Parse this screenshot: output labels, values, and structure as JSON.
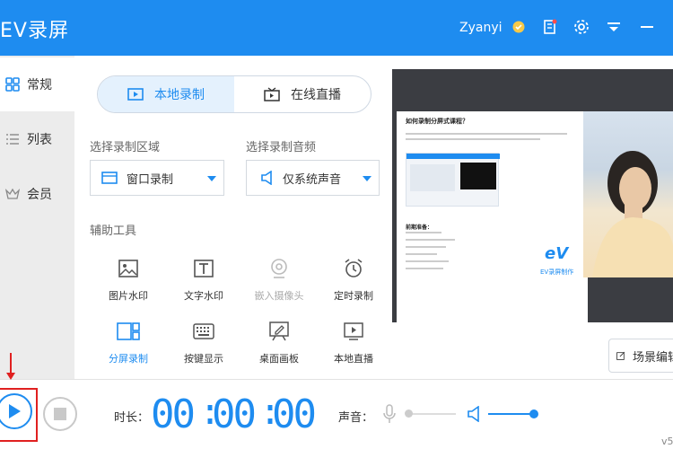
{
  "app": {
    "title": "EV录屏",
    "user": "Zyanyi",
    "version": "v5"
  },
  "sidebar": {
    "items": [
      {
        "label": "常规",
        "icon": "grid-icon"
      },
      {
        "label": "列表",
        "icon": "list-icon"
      },
      {
        "label": "会员",
        "icon": "crown-icon"
      }
    ]
  },
  "mode_tabs": [
    {
      "label": "本地录制",
      "icon": "local-record-icon",
      "active": true
    },
    {
      "label": "在线直播",
      "icon": "live-tv-icon",
      "active": false
    }
  ],
  "capture": {
    "area_label": "选择录制区域",
    "area_value": "窗口录制",
    "audio_label": "选择录制音频",
    "audio_value": "仅系统声音"
  },
  "tools": {
    "label": "辅助工具",
    "items": [
      {
        "label": "图片水印",
        "icon": "image-icon"
      },
      {
        "label": "文字水印",
        "icon": "text-icon"
      },
      {
        "label": "嵌入摄像头",
        "icon": "webcam-icon"
      },
      {
        "label": "定时录制",
        "icon": "alarm-clock-icon"
      },
      {
        "label": "分屏录制",
        "icon": "split-screen-icon"
      },
      {
        "label": "按键显示",
        "icon": "keyboard-icon"
      },
      {
        "label": "桌面画板",
        "icon": "whiteboard-icon"
      },
      {
        "label": "本地直播",
        "icon": "local-live-icon"
      }
    ]
  },
  "preview": {
    "slide_title": "如何录制分屏式课程？",
    "slide_heading": "前期准备：",
    "logo": "EV录屏制作"
  },
  "scene_button": "场景编辑",
  "bottom": {
    "duration_label": "时长：",
    "timer": [
      "00",
      "00",
      "00"
    ],
    "sound_label": "声音："
  },
  "colors": {
    "accent": "#1e8cf0",
    "record_border": "#e02020"
  }
}
